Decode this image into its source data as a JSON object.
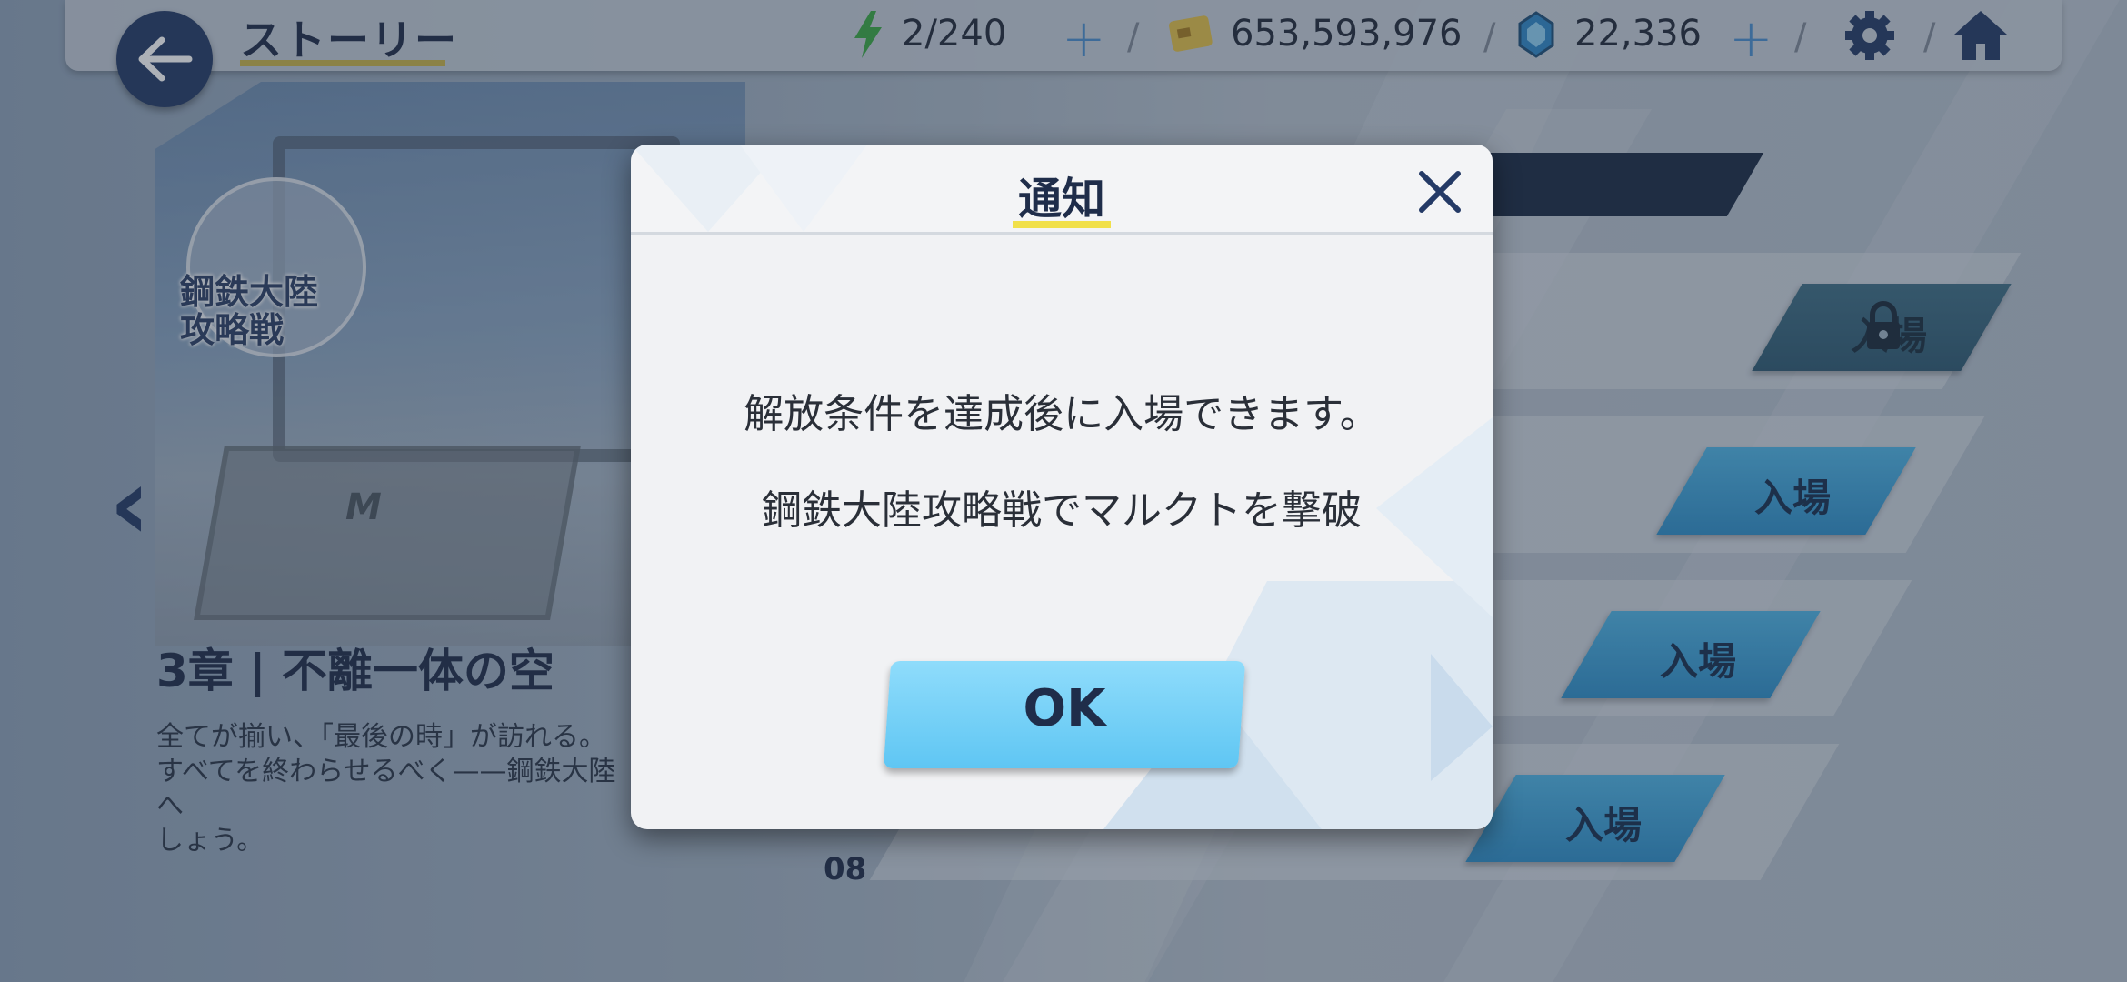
{
  "header": {
    "title": "ストーリー",
    "stamina": "2/240",
    "credits": "653,593,976",
    "gems": "22,336"
  },
  "left_panel": {
    "event_logo_text": "鋼鉄大陸\n攻略戦",
    "chapter_title": "3章 | 不離一体の空",
    "chapter_desc": "全てが揃い、「最後の時」が訪れる。\nすべてを終わらせるべく——鋼鉄大陸へ\nしょう。"
  },
  "list": {
    "enter_label": "入場",
    "row_number": "08"
  },
  "modal": {
    "title": "通知",
    "message": "解放条件を達成後に入場できます。",
    "condition": "鋼鉄大陸攻略戦でマルクトを撃破",
    "ok_label": "OK"
  },
  "colors": {
    "accent_dark": "#243a66",
    "title_underline": "#f1e04a",
    "enter_button": "#2f8fc9",
    "ok_button": "#6cccf5"
  },
  "icons": [
    "back-arrow-icon",
    "stamina-bolt-icon",
    "plus-icon",
    "credit-card-icon",
    "gem-icon",
    "gear-icon",
    "home-icon",
    "chevron-left-icon",
    "lock-icon",
    "close-icon"
  ]
}
